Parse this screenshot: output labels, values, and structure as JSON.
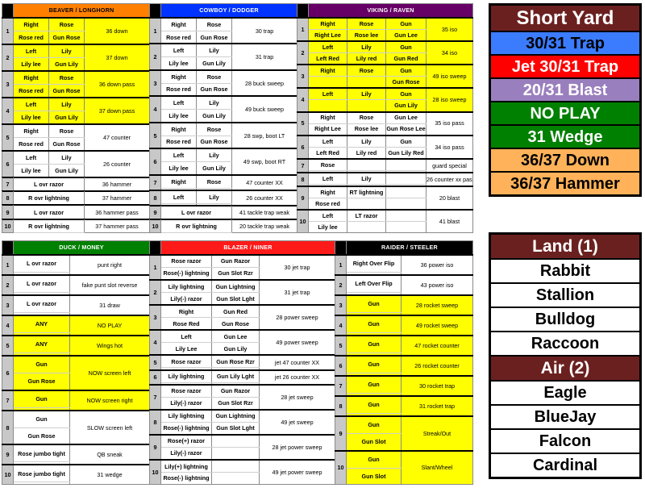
{
  "sections": [
    {
      "id": "beaver-longhorn",
      "title": "BEAVER / LONGHORN",
      "header_bg": "#ff8000",
      "header_fg": "#000000",
      "cols": 2,
      "rows": [
        {
          "n": "1",
          "bg": "yellow",
          "fmt": [
            [
              "Right",
              "Rose"
            ],
            [
              "Rose red",
              "Gun Rose"
            ]
          ],
          "play": "36 down"
        },
        {
          "n": "2",
          "bg": "yellow",
          "fmt": [
            [
              "Left",
              "Lily"
            ],
            [
              "Lily lee",
              "Gun Lily"
            ]
          ],
          "play": "37 down"
        },
        {
          "n": "3",
          "bg": "yellow",
          "fmt": [
            [
              "Right",
              "Rose"
            ],
            [
              "Rose red",
              "Gun Rose"
            ]
          ],
          "play": "36 down pass"
        },
        {
          "n": "4",
          "bg": "yellow",
          "fmt": [
            [
              "Left",
              "Lily"
            ],
            [
              "Lily lee",
              "Gun Lily"
            ]
          ],
          "play": "37 down pass"
        },
        {
          "n": "5",
          "bg": "white",
          "fmt": [
            [
              "Right",
              "Rose"
            ],
            [
              "Rose red",
              "Gun Rose"
            ]
          ],
          "play": "47 counter"
        },
        {
          "n": "6",
          "bg": "white",
          "fmt": [
            [
              "Left",
              "Lily"
            ],
            [
              "Lily lee",
              "Gun Lily"
            ]
          ],
          "play": "26 counter"
        },
        {
          "n": "7",
          "bg": "white",
          "fmt": [
            [
              "L ovr razor",
              ""
            ],
            [
              "",
              ""
            ]
          ],
          "span": true,
          "play": "36 hammer"
        },
        {
          "n": "8",
          "bg": "white",
          "fmt": [
            [
              "R ovr lightning",
              ""
            ],
            [
              "",
              ""
            ]
          ],
          "span": true,
          "play": "37 hammer"
        },
        {
          "n": "9",
          "bg": "white",
          "fmt": [
            [
              "L ovr razor",
              ""
            ],
            [
              "",
              ""
            ]
          ],
          "span": true,
          "play": "36 hammer pass"
        },
        {
          "n": "10",
          "bg": "white",
          "fmt": [
            [
              "R ovr lightning",
              ""
            ],
            [
              "",
              ""
            ]
          ],
          "span": true,
          "play": "37 hammer pass"
        }
      ]
    },
    {
      "id": "cowboy-dodger",
      "title": "COWBOY / DODGER",
      "header_bg": "#0033ff",
      "header_fg": "#ffffff",
      "cols": 2,
      "rows": [
        {
          "n": "1",
          "bg": "white",
          "fmt": [
            [
              "Right",
              "Rose"
            ],
            [
              "Rose red",
              "Gun Rose"
            ]
          ],
          "play": "30 trap"
        },
        {
          "n": "2",
          "bg": "white",
          "fmt": [
            [
              "Left",
              "Lily"
            ],
            [
              "Lily lee",
              "Gun Lily"
            ]
          ],
          "play": "31 trap"
        },
        {
          "n": "3",
          "bg": "white",
          "fmt": [
            [
              "Right",
              "Rose"
            ],
            [
              "Rose red",
              "Gun Rose"
            ]
          ],
          "play": "28 buck sweep"
        },
        {
          "n": "4",
          "bg": "white",
          "fmt": [
            [
              "Left",
              "Lily"
            ],
            [
              "Lily lee",
              "Gun Lily"
            ]
          ],
          "play": "49 buck sweep"
        },
        {
          "n": "5",
          "bg": "white",
          "fmt": [
            [
              "Right",
              "Rose"
            ],
            [
              "Rose red",
              "Gun Rose"
            ]
          ],
          "play": "28 swp, boot LT"
        },
        {
          "n": "6",
          "bg": "white",
          "fmt": [
            [
              "Left",
              "Lily"
            ],
            [
              "Lily lee",
              "Gun Lily"
            ]
          ],
          "play": "49 swp, boot RT"
        },
        {
          "n": "7",
          "bg": "white",
          "fmt": [
            [
              "Right",
              "Rose"
            ],
            [
              "",
              ""
            ]
          ],
          "play": "47 counter XX"
        },
        {
          "n": "8",
          "bg": "white",
          "fmt": [
            [
              "Left",
              "Lily"
            ],
            [
              "",
              ""
            ]
          ],
          "play": "26 counter XX"
        },
        {
          "n": "9",
          "bg": "white",
          "fmt": [
            [
              "L ovr razor",
              ""
            ],
            [
              "",
              ""
            ]
          ],
          "span": true,
          "play": "41 tackle trap weak"
        },
        {
          "n": "10",
          "bg": "white",
          "fmt": [
            [
              "R ovr lightning",
              ""
            ],
            [
              "",
              ""
            ]
          ],
          "span": true,
          "play": "20 tackle trap weak"
        }
      ]
    },
    {
      "id": "viking-raven",
      "title": "VIKING / RAVEN",
      "header_bg": "#660066",
      "header_fg": "#ffffff",
      "cols": 3,
      "rows": [
        {
          "n": "1",
          "bg": "yellow",
          "fmt": [
            [
              "Right",
              "Rose",
              "Gun"
            ],
            [
              "Right Lee",
              "Rose lee",
              "Gun Lee"
            ]
          ],
          "play": "35 iso"
        },
        {
          "n": "2",
          "bg": "yellow",
          "fmt": [
            [
              "Left",
              "Lily",
              "Gun"
            ],
            [
              "Left Red",
              "Lily red",
              "Gun Red"
            ]
          ],
          "play": "34 iso"
        },
        {
          "n": "3",
          "bg": "yellow",
          "fmt": [
            [
              "Right",
              "Rose",
              "Gun"
            ],
            [
              "",
              "",
              "Gun Rose"
            ]
          ],
          "play": "49 iso sweep"
        },
        {
          "n": "4",
          "bg": "yellow",
          "fmt": [
            [
              "Left",
              "Lily",
              "Gun"
            ],
            [
              "",
              "",
              "Gun Lily"
            ]
          ],
          "play": "28 iso sweep"
        },
        {
          "n": "5",
          "bg": "white",
          "fmt": [
            [
              "Right",
              "Rose",
              "Gun Lee"
            ],
            [
              "Right Lee",
              "Rose lee",
              "Gun Rose Lee"
            ]
          ],
          "play": "35 iso pass"
        },
        {
          "n": "6",
          "bg": "white",
          "fmt": [
            [
              "Left",
              "Lily",
              "Gun"
            ],
            [
              "Left Red",
              "Lily red",
              "Gun Lily Red"
            ]
          ],
          "play": "34 iso pass"
        },
        {
          "n": "7",
          "bg": "white",
          "fmt": [
            [
              "Rose",
              "",
              ""
            ],
            [
              "",
              "",
              ""
            ]
          ],
          "play": "guard special"
        },
        {
          "n": "8",
          "bg": "white",
          "fmt": [
            [
              "Left",
              "Lily",
              ""
            ],
            [
              "",
              "",
              ""
            ]
          ],
          "play": "26 counter xx pass"
        },
        {
          "n": "9",
          "bg": "white",
          "fmt": [
            [
              "Right",
              "RT lightning",
              ""
            ],
            [
              "Rose red",
              "",
              ""
            ]
          ],
          "play": "20 blast"
        },
        {
          "n": "10",
          "bg": "white",
          "fmt": [
            [
              "Left",
              "LT razor",
              ""
            ],
            [
              "Lily lee",
              "",
              ""
            ]
          ],
          "play": "41 blast"
        }
      ]
    },
    {
      "id": "duck-money",
      "title": "DUCK / MONEY",
      "header_bg": "#008000",
      "header_fg": "#ffffff",
      "cols": 1,
      "rows": [
        {
          "n": "1",
          "bg": "white",
          "fmt": [
            [
              "L ovr razor"
            ],
            [
              ""
            ]
          ],
          "play": "punt right"
        },
        {
          "n": "2",
          "bg": "white",
          "fmt": [
            [
              "L ovr razor"
            ],
            [
              ""
            ]
          ],
          "play": "fake punt slot reverse"
        },
        {
          "n": "3",
          "bg": "white",
          "fmt": [
            [
              "L ovr razor"
            ],
            [
              ""
            ]
          ],
          "play": "31 draw"
        },
        {
          "n": "4",
          "bg": "yellow",
          "fmt": [
            [
              "ANY"
            ],
            [
              ""
            ]
          ],
          "play": "NO PLAY",
          "big": true
        },
        {
          "n": "5",
          "bg": "yellow",
          "fmt": [
            [
              "ANY"
            ],
            [
              ""
            ]
          ],
          "play": "Wings hot"
        },
        {
          "n": "6",
          "bg": "yellow",
          "fmt": [
            [
              "Gun"
            ],
            [
              "Gun Rose"
            ]
          ],
          "play": "NOW screen left"
        },
        {
          "n": "7",
          "bg": "yellow",
          "fmt": [
            [
              "Gun"
            ],
            [
              ""
            ]
          ],
          "play": "NOW screen right"
        },
        {
          "n": "8",
          "bg": "white",
          "fmt": [
            [
              "Gun"
            ],
            [
              "Gun Rose"
            ]
          ],
          "play": "SLOW screen left"
        },
        {
          "n": "9",
          "bg": "white",
          "fmt": [
            [
              "Rose jumbo tight"
            ],
            [
              ""
            ]
          ],
          "play": "QB sneak"
        },
        {
          "n": "10",
          "bg": "white",
          "fmt": [
            [
              "Rose jumbo tight"
            ],
            [
              ""
            ]
          ],
          "play": "31 wedge"
        }
      ]
    },
    {
      "id": "blazer-niner",
      "title": "BLAZER / NINER",
      "header_bg": "#ff1a1a",
      "header_fg": "#ffffff",
      "cols": 2,
      "rows": [
        {
          "n": "1",
          "bg": "white",
          "fmt": [
            [
              "Rose razor",
              "Gun Razor"
            ],
            [
              "Rose(-) lightning",
              "Gun Slot Rzr"
            ]
          ],
          "play": "30 jet trap"
        },
        {
          "n": "2",
          "bg": "white",
          "fmt": [
            [
              "Lily lightning",
              "Gun Lightning"
            ],
            [
              "Lily(-) razor",
              "Gun Slot Lght"
            ]
          ],
          "play": "31 jet trap"
        },
        {
          "n": "3",
          "bg": "white",
          "fmt": [
            [
              "Right",
              "Gun Red"
            ],
            [
              "Rose Red",
              "Gun Rose"
            ]
          ],
          "play": "28 power sweep"
        },
        {
          "n": "4",
          "bg": "white",
          "fmt": [
            [
              "Left",
              "Gun Lee"
            ],
            [
              "Lily Lee",
              "Gun Lily"
            ]
          ],
          "play": "49 power sweep"
        },
        {
          "n": "5",
          "bg": "white",
          "fmt": [
            [
              "Rose razor",
              "Gun Rose Rzr"
            ],
            [
              "",
              ""
            ]
          ],
          "play": "jet 47 counter XX"
        },
        {
          "n": "6",
          "bg": "white",
          "fmt": [
            [
              "Lily lightning",
              "Gun Lily Lght"
            ],
            [
              "",
              ""
            ]
          ],
          "play": "jet 26 counter XX"
        },
        {
          "n": "7",
          "bg": "white",
          "fmt": [
            [
              "Rose razor",
              "Gun Razor"
            ],
            [
              "Lily(-) razor",
              "Gun Slot Rzr"
            ]
          ],
          "play": "28 jet sweep"
        },
        {
          "n": "8",
          "bg": "white",
          "fmt": [
            [
              "Lily lightning",
              "Gun Lightning"
            ],
            [
              "Rose(-) lightning",
              "Gun Slot Lght"
            ]
          ],
          "play": "49 jet sweep"
        },
        {
          "n": "9",
          "bg": "white",
          "fmt": [
            [
              "Rose(+) razor",
              ""
            ],
            [
              "Lily(-) razor",
              ""
            ]
          ],
          "play": "28 jet power sweep"
        },
        {
          "n": "10",
          "bg": "white",
          "fmt": [
            [
              "Lily(+) lightning",
              ""
            ],
            [
              "Rose(-) lightning",
              ""
            ]
          ],
          "play": "49 jet power sweep"
        }
      ]
    },
    {
      "id": "raider-steeler",
      "title": "RAIDER / STEELER",
      "header_bg": "#000000",
      "header_fg": "#ffffff",
      "cols": 1,
      "rows": [
        {
          "n": "1",
          "bg": "white",
          "fmt": [
            [
              "Right Over Flip"
            ],
            [
              ""
            ]
          ],
          "play": "36 power iso"
        },
        {
          "n": "2",
          "bg": "white",
          "fmt": [
            [
              "Left Over Flip"
            ],
            [
              ""
            ]
          ],
          "play": "43 power iso"
        },
        {
          "n": "3",
          "bg": "yellow",
          "fmt": [
            [
              "Gun"
            ],
            [
              ""
            ]
          ],
          "play": "28 rocket sweep"
        },
        {
          "n": "4",
          "bg": "yellow",
          "fmt": [
            [
              "Gun"
            ],
            [
              ""
            ]
          ],
          "play": "49 rocket sweep"
        },
        {
          "n": "5",
          "bg": "yellow",
          "fmt": [
            [
              "Gun"
            ],
            [
              ""
            ]
          ],
          "play": "47 rocket counter"
        },
        {
          "n": "6",
          "bg": "yellow",
          "fmt": [
            [
              "Gun"
            ],
            [
              ""
            ]
          ],
          "play": "26 rocket counter"
        },
        {
          "n": "7",
          "bg": "yellow",
          "fmt": [
            [
              "Gun"
            ],
            [
              ""
            ]
          ],
          "play": "30 rocket trap"
        },
        {
          "n": "8",
          "bg": "yellow",
          "fmt": [
            [
              "Gun"
            ],
            [
              ""
            ]
          ],
          "play": "31 rocket trap"
        },
        {
          "n": "9",
          "bg": "yellow",
          "fmt": [
            [
              "Gun"
            ],
            [
              "Gun Slot"
            ]
          ],
          "play": "Streak/Out"
        },
        {
          "n": "10",
          "bg": "yellow",
          "fmt": [
            [
              "Gun"
            ],
            [
              "Gun Slot"
            ]
          ],
          "play": "Slant/Wheel"
        }
      ]
    }
  ],
  "short_yard": {
    "title": "Short Yard",
    "title_bg": "#6b2020",
    "title_fg": "#ffffff",
    "rows": [
      {
        "label": "30/31 Trap",
        "bg": "#3b7cff",
        "fg": "#000000"
      },
      {
        "label": "Jet 30/31 Trap",
        "bg": "#ff0000",
        "fg": "#ffffff"
      },
      {
        "label": "20/31 Blast",
        "bg": "#9a7fbe",
        "fg": "#ffffff"
      },
      {
        "label": "NO PLAY",
        "bg": "#008000",
        "fg": "#ffffff"
      },
      {
        "label": "31 Wedge",
        "bg": "#008000",
        "fg": "#ffffff"
      },
      {
        "label": "36/37 Down",
        "bg": "#ffb259",
        "fg": "#000000"
      },
      {
        "label": "36/37 Hammer",
        "bg": "#ffb259",
        "fg": "#000000"
      }
    ]
  },
  "land_air": {
    "land_title": "Land (1)",
    "land_rows": [
      "Rabbit",
      "Stallion",
      "Bulldog",
      "Raccoon"
    ],
    "air_title": "Air (2)",
    "air_rows": [
      "Eagle",
      "BlueJay",
      "Falcon",
      "Cardinal"
    ],
    "title_bg": "#6b2020",
    "title_fg": "#ffffff"
  }
}
